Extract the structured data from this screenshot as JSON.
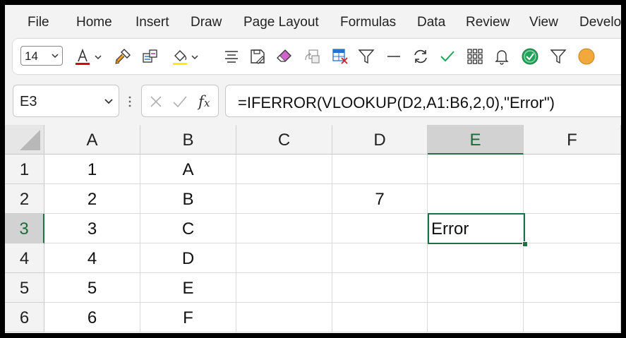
{
  "menu": {
    "tabs": [
      {
        "label": "File"
      },
      {
        "label": "Home"
      },
      {
        "label": "Insert"
      },
      {
        "label": "Draw"
      },
      {
        "label": "Page Layout"
      },
      {
        "label": "Formulas"
      },
      {
        "label": "Data"
      },
      {
        "label": "Review"
      },
      {
        "label": "View"
      },
      {
        "label": "Develo"
      }
    ]
  },
  "toolbar": {
    "font_size": "14",
    "font_color_bar": "#e00000",
    "highlight_color_bar": "#ffee00",
    "icons": [
      "font-color-icon",
      "format-painter-icon",
      "cell-styles-icon",
      "fill-color-icon",
      "align-icon",
      "save-as-icon",
      "eraser-icon",
      "paste-icon",
      "delete-table-icon",
      "filter-icon",
      "minus-icon",
      "refresh-icon",
      "checkmark-icon",
      "grid-icon",
      "bell-icon",
      "check-circle-icon",
      "filter-icon-2"
    ]
  },
  "formula_row": {
    "name_box": "E3",
    "formula": "=IFERROR(VLOOKUP(D2,A1:B6,2,0),\"Error\")"
  },
  "grid": {
    "columns": [
      "A",
      "B",
      "C",
      "D",
      "E",
      "F"
    ],
    "selected_column": "E",
    "selected_row": "3",
    "rows": [
      {
        "num": "1",
        "cells": [
          "1",
          "A",
          "",
          "",
          "",
          ""
        ]
      },
      {
        "num": "2",
        "cells": [
          "2",
          "B",
          "",
          "7",
          "",
          ""
        ]
      },
      {
        "num": "3",
        "cells": [
          "3",
          "C",
          "",
          "",
          "Error",
          ""
        ]
      },
      {
        "num": "4",
        "cells": [
          "4",
          "D",
          "",
          "",
          "",
          ""
        ]
      },
      {
        "num": "5",
        "cells": [
          "5",
          "E",
          "",
          "",
          "",
          ""
        ]
      },
      {
        "num": "6",
        "cells": [
          "6",
          "F",
          "",
          "",
          "",
          ""
        ]
      }
    ]
  },
  "colors": {
    "accent": "#1e7145",
    "check_green": "#22a35a"
  }
}
